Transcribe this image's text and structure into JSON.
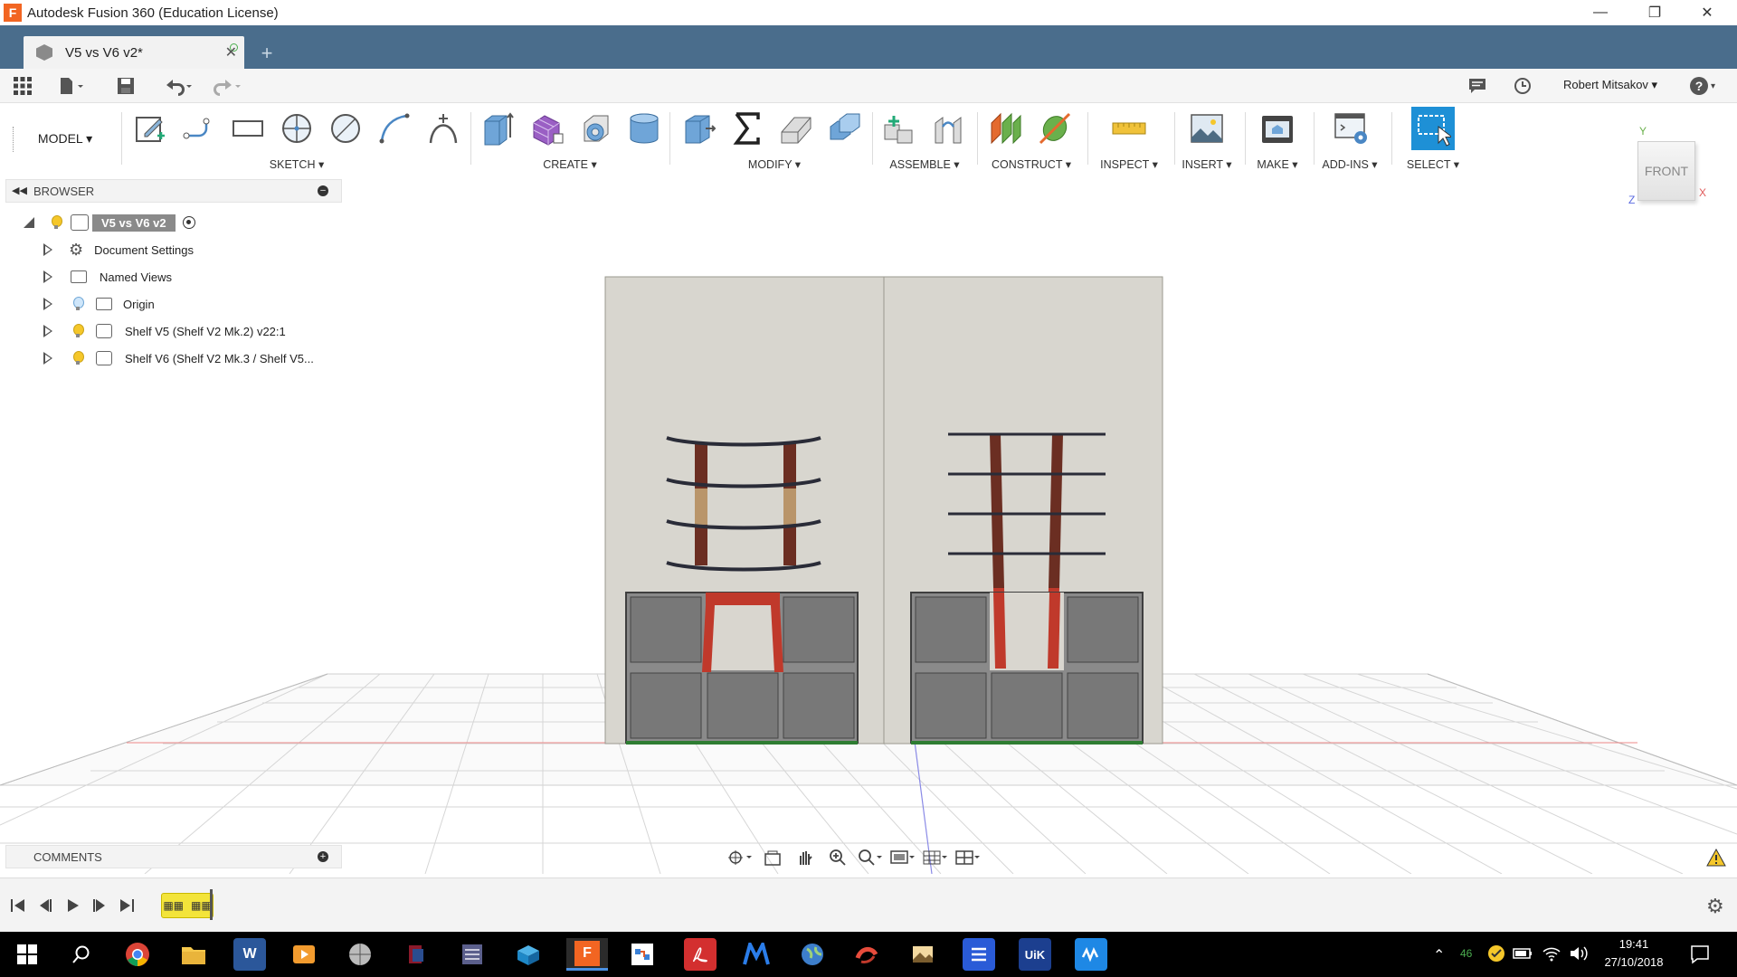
{
  "window": {
    "title": "Autodesk Fusion 360 (Education License)",
    "app_icon_letter": "F"
  },
  "tab": {
    "title": "V5 vs V6 v2*",
    "close": "✕",
    "new_tab": "+"
  },
  "quick_access": {
    "user": "Robert Mitsakov ▾",
    "help": "?"
  },
  "toolbar": {
    "workspace": "MODEL ▾",
    "groups": [
      {
        "label": "SKETCH ▾"
      },
      {
        "label": "CREATE ▾"
      },
      {
        "label": "MODIFY ▾"
      },
      {
        "label": "ASSEMBLE ▾"
      },
      {
        "label": "CONSTRUCT ▾"
      },
      {
        "label": "INSPECT ▾"
      },
      {
        "label": "INSERT ▾"
      },
      {
        "label": "MAKE ▾"
      },
      {
        "label": "ADD-INS ▾"
      },
      {
        "label": "SELECT ▾"
      }
    ]
  },
  "viewcube": {
    "face": "FRONT",
    "axis_x": "X",
    "axis_y": "Y",
    "axis_z": "Z"
  },
  "browser": {
    "title": "BROWSER",
    "root": "V5 vs V6 v2",
    "items": [
      {
        "label": "Document Settings",
        "icon": "gear-icon"
      },
      {
        "label": "Named Views",
        "icon": "folder-icon"
      },
      {
        "label": "Origin",
        "icon": "folder-icon"
      },
      {
        "label": "Shelf V5 (Shelf V2 Mk.2) v22:1",
        "icon": "component-icon"
      },
      {
        "label": "Shelf V6 (Shelf V2 Mk.3 / Shelf V5...",
        "icon": "component-icon"
      }
    ]
  },
  "comments": {
    "title": "COMMENTS"
  },
  "taskbar": {
    "time": "19:41",
    "date": "27/10/2018",
    "tray_count": "46",
    "apps": [
      "start",
      "search",
      "chrome",
      "file-explorer",
      "word",
      "media",
      "app",
      "app",
      "app",
      "app",
      "fusion-360",
      "app",
      "acrobat",
      "app",
      "app",
      "app",
      "app",
      "app",
      "app",
      "app"
    ]
  },
  "colors": {
    "tab_bar": "#4a6d8c",
    "select_active": "#1e90d6",
    "accent_red": "#c0392b",
    "wood_dark": "#6b2e22"
  }
}
